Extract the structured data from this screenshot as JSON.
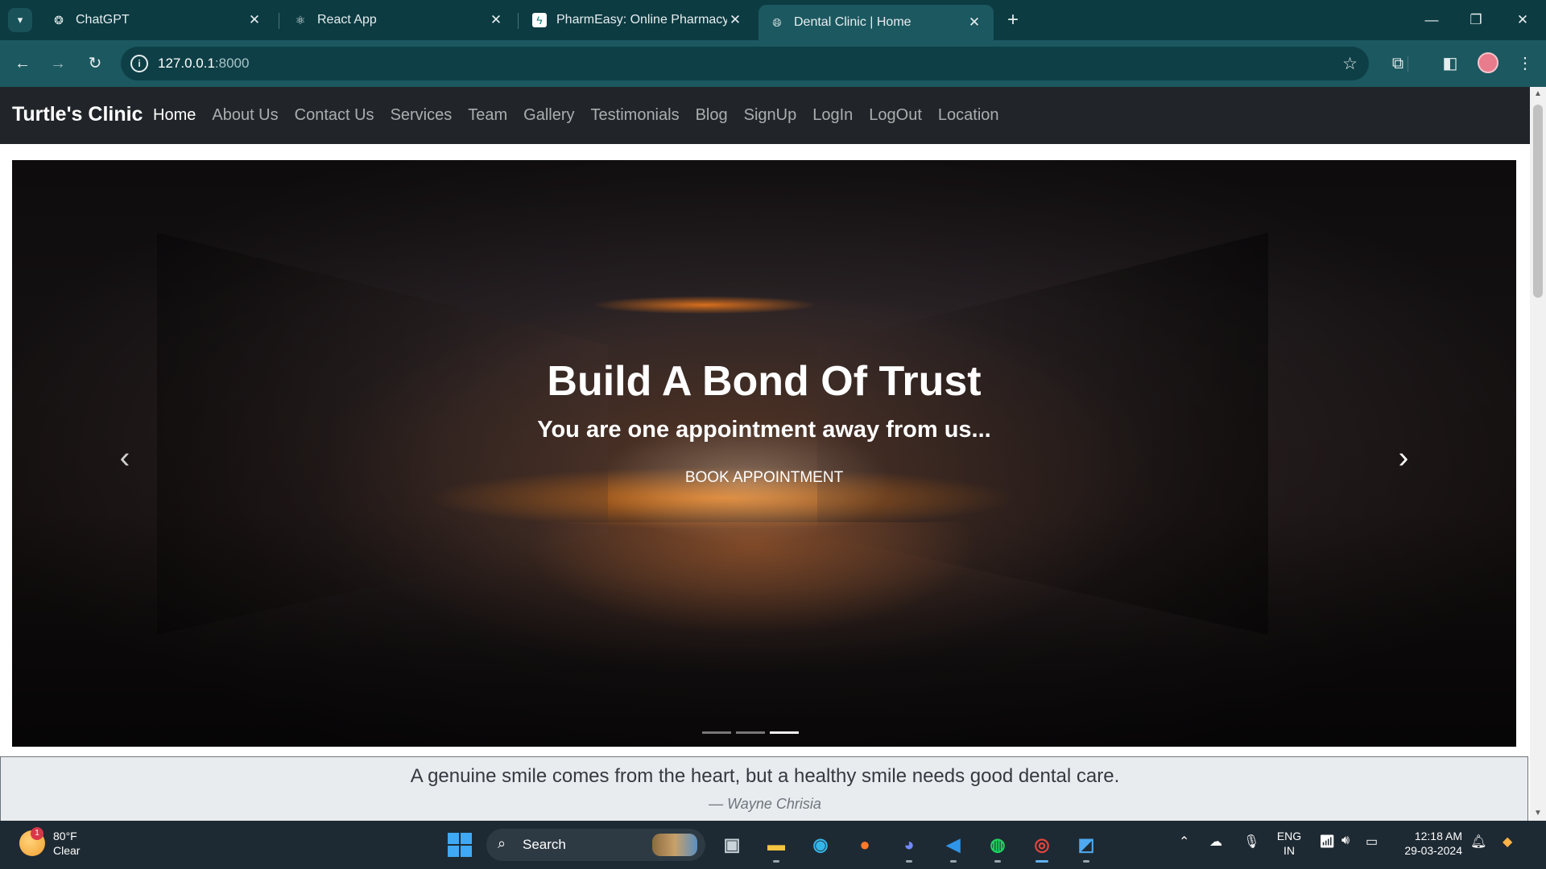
{
  "browser": {
    "tabs": [
      {
        "title": "ChatGPT",
        "icon": "chatgpt-icon"
      },
      {
        "title": "React App",
        "icon": "react-icon"
      },
      {
        "title": "PharmEasy: Online Pharmacy &",
        "icon": "pharmeasy-icon"
      },
      {
        "title": "Dental Clinic | Home",
        "icon": "globe-icon"
      }
    ],
    "active_tab": 3,
    "url_host": "127.0.0.1",
    "url_port": ":8000"
  },
  "site": {
    "brand": "Turtle's Clinic",
    "nav": [
      "Home",
      "About Us",
      "Contact Us",
      "Services",
      "Team",
      "Gallery",
      "Testimonials",
      "Blog",
      "SignUp",
      "LogIn",
      "LogOut",
      "Location"
    ],
    "active_nav": "Home",
    "hero": {
      "title": "Build A Bond Of Trust",
      "subtitle": "You are one appointment away from us...",
      "button": "BOOK APPOINTMENT",
      "slides": 3,
      "active_slide": 3
    },
    "quote": {
      "text": "A genuine smile comes from the heart, but a healthy smile needs good dental care.",
      "author": "— Wayne Chrisia"
    }
  },
  "taskbar": {
    "weather_temp": "80°F",
    "weather_desc": "Clear",
    "weather_badge": "1",
    "search_label": "Search",
    "lang_line1": "ENG",
    "lang_line2": "IN",
    "time": "12:18 AM",
    "date": "29-03-2024"
  },
  "colors": {
    "chrome_dark": "#0c3b42",
    "chrome_toolbar": "#1c5860",
    "navbar": "#212529",
    "quote_bg": "#e9ecef",
    "taskbar": "#1e2a33"
  }
}
